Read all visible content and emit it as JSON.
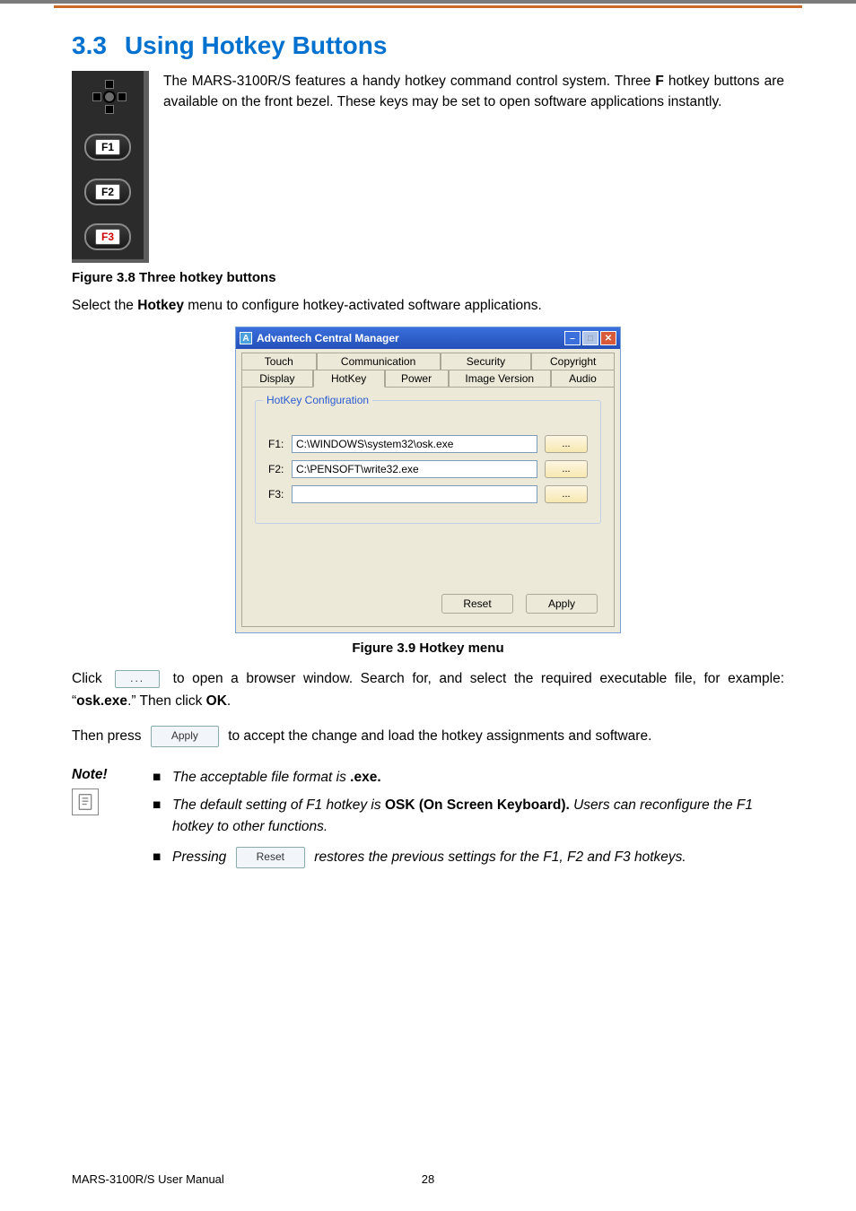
{
  "section": {
    "number": "3.3",
    "title": "Using Hotkey Buttons"
  },
  "intro": {
    "pre": "The MARS-3100R/S features a handy hotkey command control system. Three ",
    "bold": "F",
    "post": " hotkey buttons are available on the front bezel. These keys may be set to open software applications instantly."
  },
  "hotkey_panel": {
    "f1": "F1",
    "f2": "F2",
    "f3": "F3"
  },
  "caption1": "Figure 3.8 Three hotkey buttons",
  "select_line": {
    "pre": "Select the ",
    "bold": "Hotkey",
    "post": " menu to configure hotkey-activated software applications."
  },
  "acm": {
    "title": "Advantech Central Manager",
    "icon_letter": "A",
    "tabs_top": [
      "Touch",
      "Communication",
      "Security",
      "Copyright"
    ],
    "tabs_bottom": [
      "Display",
      "HotKey",
      "Power",
      "Image Version",
      "Audio"
    ],
    "active_tab": "HotKey",
    "legend": "HotKey Configuration",
    "rows": [
      {
        "label": "F1:",
        "value": "C:\\WINDOWS\\system32\\osk.exe",
        "browse": "..."
      },
      {
        "label": "F2:",
        "value": "C:\\PENSOFT\\write32.exe",
        "browse": "..."
      },
      {
        "label": "F3:",
        "value": "",
        "browse": "..."
      }
    ],
    "buttons": {
      "reset": "Reset",
      "apply": "Apply"
    }
  },
  "caption2": "Figure 3.9 Hotkey menu",
  "click_para": {
    "pre": "Click ",
    "ellipsis": "...",
    "mid": " to open a browser window. Search for, and select the required executable file, for example: “",
    "bold": "osk.exe",
    "post1": ".” Then click ",
    "ok": "OK",
    "period": "."
  },
  "then_para": {
    "pre": "Then press ",
    "apply": "Apply",
    "mid": " to accept the change and load the hotkey assignments and software."
  },
  "note": {
    "label": "Note!",
    "items": [
      {
        "pre": "The acceptable file format is ",
        "bold": ".exe.",
        "post": ""
      },
      {
        "pre": "The default setting of F1 hotkey is ",
        "bold": "OSK (On Screen Keyboard).",
        "post": " Users can reconfigure the F1 hotkey to other functions."
      },
      {
        "pre": "Pressing ",
        "button": "Reset",
        "mid": " restores the previous settings for the F1, F2 and F3 hotkeys.",
        "post": ""
      }
    ]
  },
  "footer": {
    "manual": "MARS-3100R/S User Manual",
    "page": "28"
  }
}
